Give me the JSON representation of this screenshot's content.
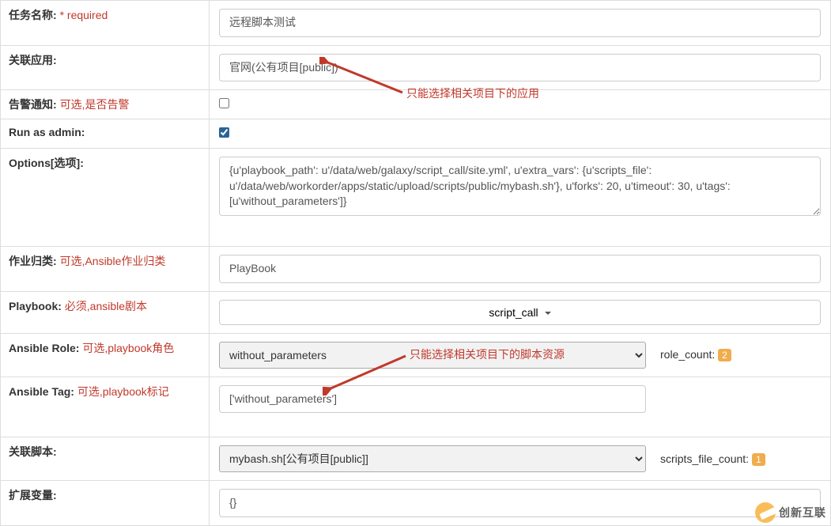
{
  "labels": {
    "task_name": "任务名称:",
    "task_name_hint": "* required",
    "related_app": "关联应用:",
    "alert": "告警通知:",
    "alert_hint": "可选,是否告警",
    "run_as_admin": "Run as admin:",
    "options": "Options[选项]:",
    "job_cat": "作业归类:",
    "job_cat_hint": "可选,Ansible作业归类",
    "playbook": "Playbook:",
    "playbook_hint": "必须,ansible剧本",
    "ansible_role": "Ansible Role:",
    "ansible_role_hint": "可选,playbook角色",
    "ansible_tag": "Ansible Tag:",
    "ansible_tag_hint": "可选,playbook标记",
    "related_script": "关联脚本:",
    "ext_vars": "扩展变量:"
  },
  "fields": {
    "task_name": "远程脚本测试",
    "related_app": "官网(公有项目[public])",
    "alert_checked": false,
    "run_as_admin_checked": true,
    "options_text": "{u'playbook_path': u'/data/web/galaxy/script_call/site.yml', u'extra_vars': {u'scripts_file': u'/data/web/workorder/apps/static/upload/scripts/public/mybash.sh'}, u'forks': 20, u'timeout': 30, u'tags': [u'without_parameters']}",
    "job_cat": "PlayBook",
    "playbook_selected": "script_call",
    "ansible_role_selected": "without_parameters",
    "role_count_label": "role_count:",
    "role_count": "2",
    "ansible_tag": "['without_parameters']",
    "related_script_selected": "mybash.sh[公有项目[public]]",
    "scripts_file_count_label": "scripts_file_count:",
    "scripts_file_count": "1",
    "ext_vars": "{}"
  },
  "annotations": {
    "a1": "只能选择相关项目下的应用",
    "a2": "只能选择相关项目下的脚本资源"
  },
  "brand": "创新互联"
}
